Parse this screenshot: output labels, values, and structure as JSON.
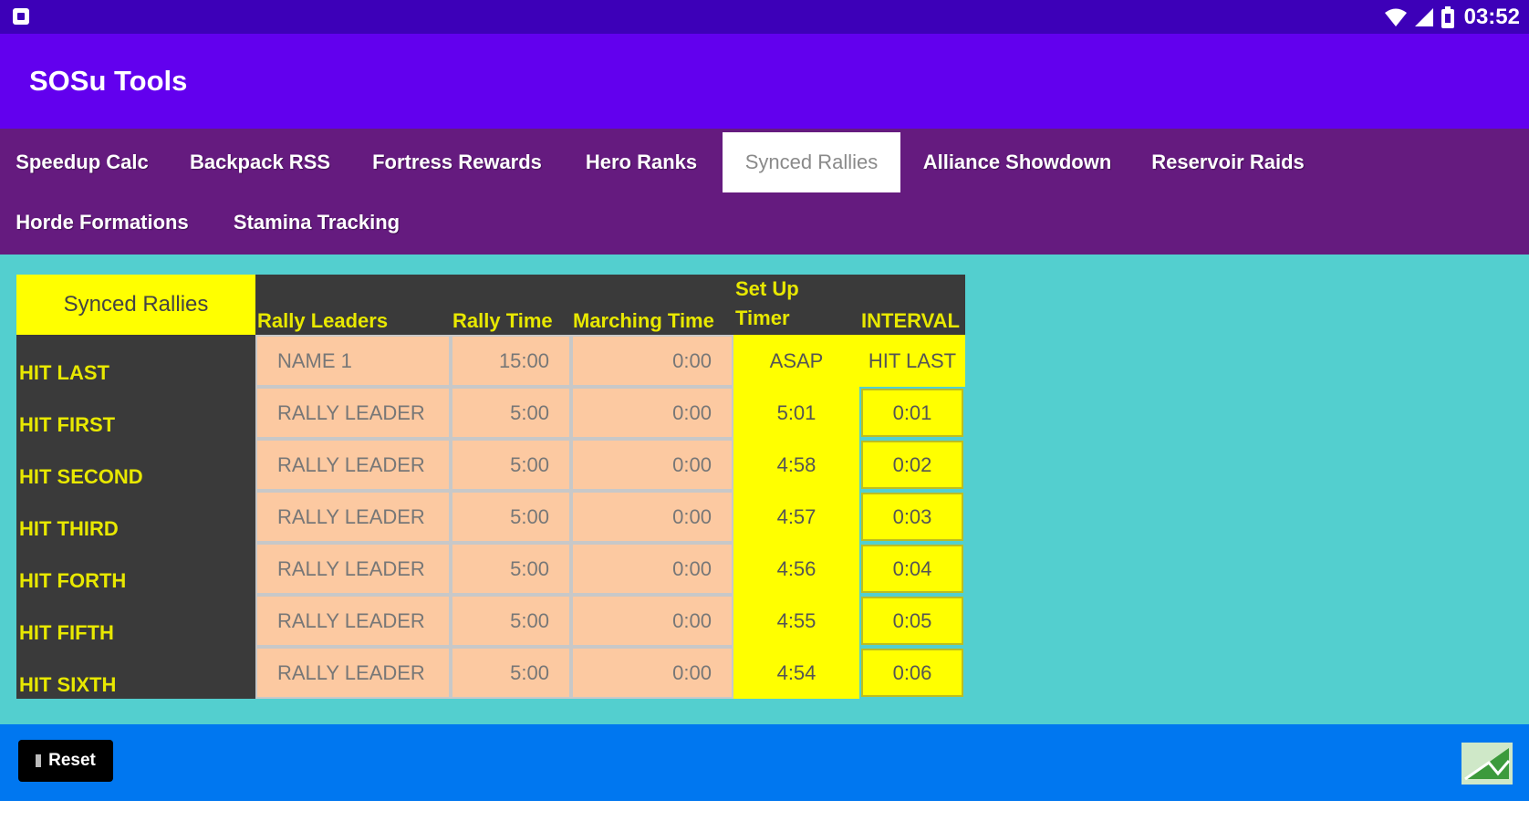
{
  "status_bar": {
    "time": "03:52",
    "icons": [
      "notification-icon",
      "wifi-icon",
      "signal-icon",
      "battery-icon"
    ]
  },
  "app": {
    "title": "SOSu Tools"
  },
  "tabs": [
    {
      "label": "Speedup Calc",
      "active": false
    },
    {
      "label": "Backpack RSS",
      "active": false
    },
    {
      "label": "Fortress Rewards",
      "active": false
    },
    {
      "label": "Hero Ranks",
      "active": false
    },
    {
      "label": "Synced Rallies",
      "active": true
    },
    {
      "label": "Alliance Showdown",
      "active": false
    },
    {
      "label": "Reservoir Raids",
      "active": false
    },
    {
      "label": "Horde Formations",
      "active": false
    },
    {
      "label": "Stamina Tracking",
      "active": false
    }
  ],
  "table": {
    "title": "Synced Rallies",
    "columns": [
      "Rally Leaders",
      "Rally Time",
      "Marching Time",
      "Set Up\nTimer",
      "INTERVAL"
    ],
    "rows": [
      {
        "label": "HIT LAST",
        "leader": "NAME 1",
        "rally_time": "15:00",
        "marching_time": "0:00",
        "timer": "ASAP",
        "interval": "HIT LAST"
      },
      {
        "label": "HIT FIRST",
        "leader": "RALLY LEADER",
        "rally_time": "5:00",
        "marching_time": "0:00",
        "timer": "5:01",
        "interval": "0:01"
      },
      {
        "label": "HIT SECOND",
        "leader": "RALLY LEADER",
        "rally_time": "5:00",
        "marching_time": "0:00",
        "timer": "4:58",
        "interval": "0:02"
      },
      {
        "label": "HIT THIRD",
        "leader": "RALLY LEADER",
        "rally_time": "5:00",
        "marching_time": "0:00",
        "timer": "4:57",
        "interval": "0:03"
      },
      {
        "label": "HIT FORTH",
        "leader": "RALLY LEADER",
        "rally_time": "5:00",
        "marching_time": "0:00",
        "timer": "4:56",
        "interval": "0:04"
      },
      {
        "label": "HIT FIFTH",
        "leader": "RALLY LEADER",
        "rally_time": "5:00",
        "marching_time": "0:00",
        "timer": "4:55",
        "interval": "0:05"
      },
      {
        "label": "HIT SIXTH",
        "leader": "RALLY LEADER",
        "rally_time": "5:00",
        "marching_time": "0:00",
        "timer": "4:54",
        "interval": "0:06"
      }
    ]
  },
  "bottom_bar": {
    "reset_label": "Reset",
    "corner_icon": "spreadsheet-icon"
  },
  "colors": {
    "status_bar": "#3d00b8",
    "app_bar": "#6200ee",
    "tab_bar": "#651b7f",
    "content_bg": "#53cfcf",
    "bottom_bar": "#0077f0",
    "header_bg": "#3a3a3a",
    "header_text": "#e8e800",
    "input_cell": "#fcc9a1",
    "timer_cell": "#ffff00"
  }
}
